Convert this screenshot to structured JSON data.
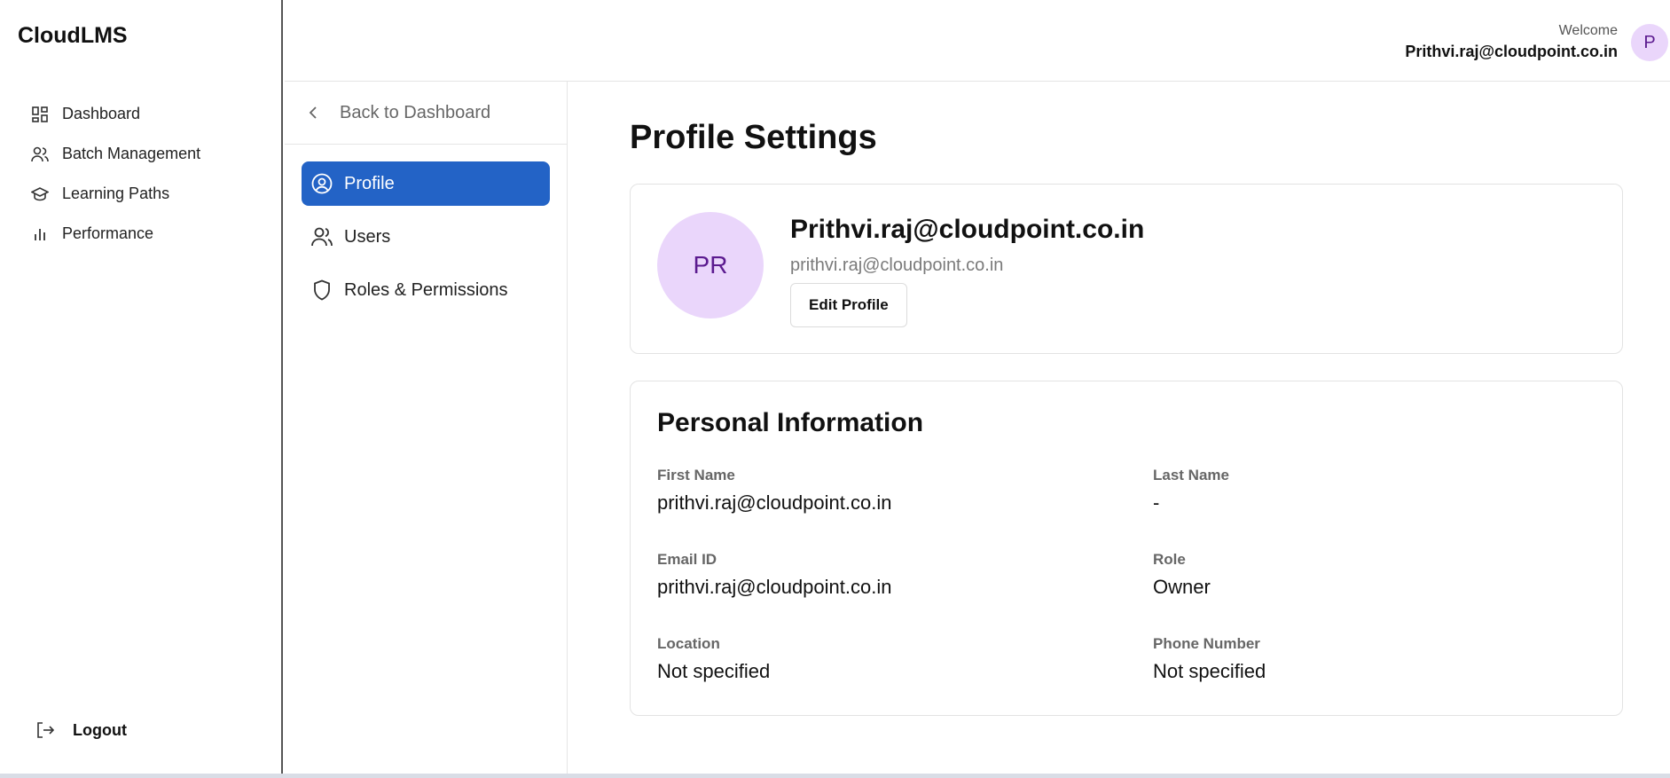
{
  "brand": "CloudLMS",
  "sidebar": {
    "items": [
      {
        "label": "Dashboard",
        "icon": "dashboard-grid-icon"
      },
      {
        "label": "Batch Management",
        "icon": "users-icon"
      },
      {
        "label": "Learning Paths",
        "icon": "graduation-cap-icon"
      },
      {
        "label": "Performance",
        "icon": "bar-chart-icon"
      }
    ],
    "logout_label": "Logout"
  },
  "header": {
    "welcome_label": "Welcome",
    "user_email": "Prithvi.raj@cloudpoint.co.in",
    "avatar_initial": "P"
  },
  "settings_nav": {
    "back_label": "Back to Dashboard",
    "items": [
      {
        "label": "Profile",
        "icon": "user-circle-icon",
        "active": true
      },
      {
        "label": "Users",
        "icon": "users-icon",
        "active": false
      },
      {
        "label": "Roles & Permissions",
        "icon": "shield-icon",
        "active": false
      }
    ]
  },
  "main": {
    "title": "Profile Settings",
    "profile": {
      "initials": "PR",
      "name": "Prithvi.raj@cloudpoint.co.in",
      "email": "prithvi.raj@cloudpoint.co.in",
      "edit_label": "Edit Profile"
    },
    "personal_info": {
      "title": "Personal Information",
      "fields": {
        "first_name": {
          "label": "First Name",
          "value": "prithvi.raj@cloudpoint.co.in"
        },
        "last_name": {
          "label": "Last Name",
          "value": "-"
        },
        "email": {
          "label": "Email ID",
          "value": "prithvi.raj@cloudpoint.co.in"
        },
        "role": {
          "label": "Role",
          "value": "Owner"
        },
        "location": {
          "label": "Location",
          "value": "Not specified"
        },
        "phone": {
          "label": "Phone Number",
          "value": "Not specified"
        }
      }
    }
  },
  "colors": {
    "accent": "#2363c6",
    "avatar_bg": "#ead6fb",
    "avatar_text": "#5b1a8f"
  }
}
